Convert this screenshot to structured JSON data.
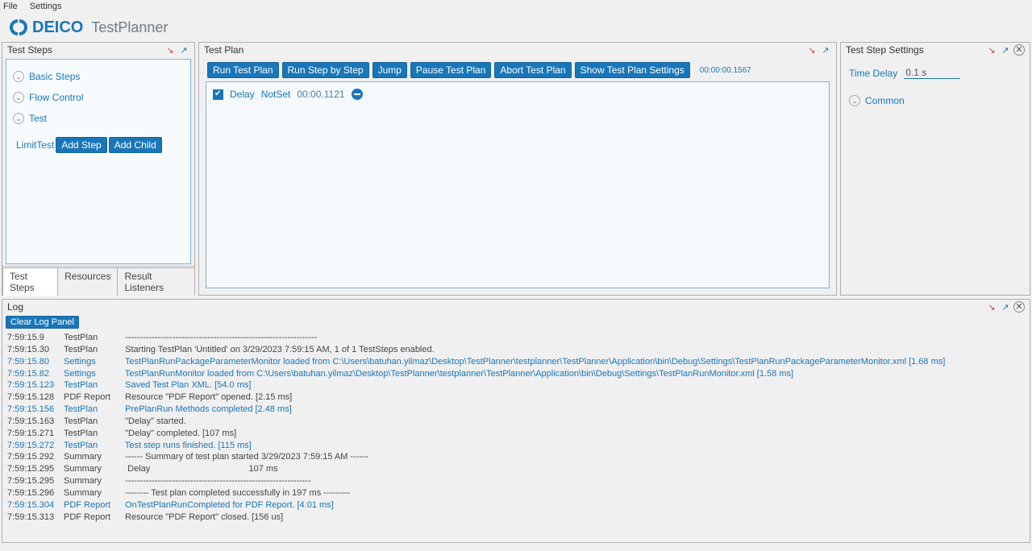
{
  "menu": {
    "file": "File",
    "settings": "Settings"
  },
  "header": {
    "brand": "DEICO",
    "product": "TestPlanner"
  },
  "test_steps": {
    "title": "Test Steps",
    "items": [
      "Basic Steps",
      "Flow Control",
      "Test"
    ],
    "limit": "LimitTest",
    "add_step": "Add Step",
    "add_child": "Add Child",
    "tabs": [
      "Test Steps",
      "Resources",
      "Result Listeners"
    ]
  },
  "test_plan": {
    "title": "Test Plan",
    "buttons": {
      "run": "Run Test Plan",
      "run_step": "Run Step by Step",
      "jump": "Jump",
      "pause": "Pause Test Plan",
      "abort": "Abort Test Plan",
      "settings": "Show Test Plan Settings"
    },
    "toolbar_time": "00:00:00.1567",
    "step": {
      "name": "Delay",
      "verdict": "NotSet",
      "time": "00:00.1121"
    }
  },
  "settings": {
    "title": "Test Step Settings",
    "time_delay_label": "Time Delay",
    "time_delay_value": "0.1 s",
    "common_label": "Common"
  },
  "log": {
    "title": "Log",
    "clear": "Clear Log Panel",
    "lines": [
      {
        "time": "7:59:15.9",
        "src": "TestPlan",
        "msg": "-----------------------------------------------------------------",
        "blue": false
      },
      {
        "time": "7:59:15.30",
        "src": "TestPlan",
        "msg": "Starting TestPlan 'Untitled' on 3/29/2023 7:59:15 AM, 1 of 1 TestSteps enabled.",
        "blue": false
      },
      {
        "time": "7:59:15.80",
        "src": "Settings",
        "msg": "TestPlanRunPackageParameterMonitor loaded from C:\\Users\\batuhan.yilmaz\\Desktop\\TestPlanner\\testplanner\\TestPlanner\\Application\\bin\\Debug\\Settings\\TestPlanRunPackageParameterMonitor.xml [1.68 ms]",
        "blue": true
      },
      {
        "time": "7:59:15.82",
        "src": "Settings",
        "msg": "TestPlanRunMonitor loaded from C:\\Users\\batuhan.yilmaz\\Desktop\\TestPlanner\\testplanner\\TestPlanner\\Application\\bin\\Debug\\Settings\\TestPlanRunMonitor.xml [1.58 ms]",
        "blue": true
      },
      {
        "time": "7:59:15.123",
        "src": "TestPlan",
        "msg": "Saved Test Plan XML. [54.0 ms]",
        "blue": true
      },
      {
        "time": "7:59:15.128",
        "src": "PDF Report",
        "msg": "Resource \"PDF Report\" opened. [2.15 ms]",
        "blue": false
      },
      {
        "time": "7:59:15.156",
        "src": "TestPlan",
        "msg": "PrePlanRun Methods completed [2.48 ms]",
        "blue": true
      },
      {
        "time": "7:59:15.163",
        "src": "TestPlan",
        "msg": "\"Delay\" started.",
        "blue": false
      },
      {
        "time": "7:59:15.271",
        "src": "TestPlan",
        "msg": "\"Delay\" completed. [107 ms]",
        "blue": false
      },
      {
        "time": "7:59:15.272",
        "src": "TestPlan",
        "msg": "Test step runs finished. [115 ms]",
        "blue": true
      },
      {
        "time": "7:59:15.292",
        "src": "Summary",
        "msg": "------ Summary of test plan started 3/29/2023 7:59:15 AM ------",
        "blue": false
      },
      {
        "time": "7:59:15.295",
        "src": "Summary",
        "msg": " Delay                                        107 ms",
        "blue": false
      },
      {
        "time": "7:59:15.295",
        "src": "Summary",
        "msg": "---------------------------------------------------------------",
        "blue": false
      },
      {
        "time": "7:59:15.296",
        "src": "Summary",
        "msg": "-------- Test plan completed successfully in 197 ms ---------",
        "blue": false
      },
      {
        "time": "7:59:15.304",
        "src": "PDF Report",
        "msg": "OnTestPlanRunCompleted for PDF Report. [4.01 ms]",
        "blue": true
      },
      {
        "time": "7:59:15.313",
        "src": "PDF Report",
        "msg": "Resource \"PDF Report\" closed. [156 us]",
        "blue": false
      }
    ]
  }
}
